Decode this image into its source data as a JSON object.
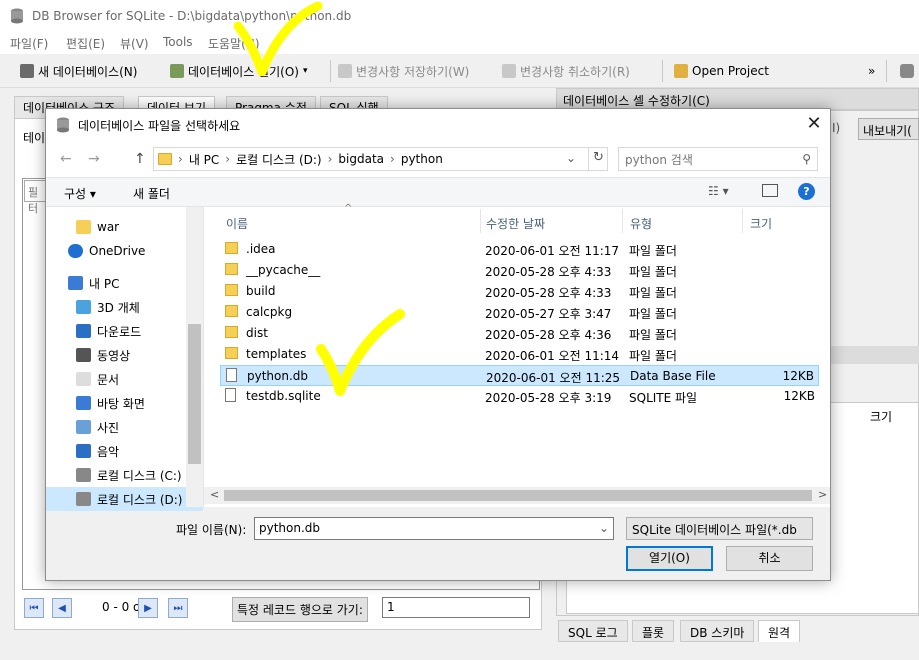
{
  "app": {
    "title": "DB Browser for SQLite - D:\\bigdata\\python\\python.db",
    "menu": [
      "파일(F)",
      "편집(E)",
      "뷰(V)",
      "Tools",
      "도움말(H)"
    ],
    "toolbar": {
      "new_db": "새 데이터베이스(N)",
      "open_db": "데이터베이스 열기(O)",
      "write_changes": "변경사항 저장하기(W)",
      "revert_changes": "변경사항 취소하기(R)",
      "open_project": "Open Project",
      "overflow": "»"
    },
    "left_tabs": [
      "데이터베이스 구조",
      "데이터 보기",
      "Pragma 수정",
      "SQL 실행"
    ],
    "table_label": "테이",
    "filter_text": "필터",
    "nav": {
      "first": "⏮",
      "prev": "◀",
      "records": "0 - 0 of 0",
      "next": "▶",
      "last": "⏭",
      "goto_label": "특정 레코드 행으로 가기:",
      "goto_value": "1"
    },
    "right_title": "데이터베이스 셀 수정하기(C)",
    "export_btn": "내보내기(",
    "i_btn": "I)",
    "size_header": "크기",
    "bottom_tabs": [
      "SQL 로그",
      "플롯",
      "DB 스키마",
      "원격"
    ]
  },
  "dialog": {
    "title": "데이터베이스 파일을 선택하세요",
    "close": "✕",
    "back": "←",
    "forward": "→",
    "up": "↑",
    "breadcrumb": [
      "내 PC",
      "로컬 디스크 (D:)",
      "bigdata",
      "python"
    ],
    "search_placeholder": "python 검색",
    "organize": "구성 ▾",
    "new_folder": "새 폴더",
    "view_icon": "☷ ▾",
    "help": "?",
    "nav_items": [
      {
        "label": "war",
        "icon": "folder-icon"
      },
      {
        "label": "OneDrive",
        "icon": "cloud-icon"
      },
      {
        "label": "내 PC",
        "icon": "pc-icon"
      },
      {
        "label": "3D 개체",
        "icon": "cube-icon"
      },
      {
        "label": "다운로드",
        "icon": "download-icon"
      },
      {
        "label": "동영상",
        "icon": "video-icon"
      },
      {
        "label": "문서",
        "icon": "document-icon"
      },
      {
        "label": "바탕 화면",
        "icon": "desktop-icon"
      },
      {
        "label": "사진",
        "icon": "pictures-icon"
      },
      {
        "label": "음악",
        "icon": "music-icon"
      },
      {
        "label": "로컬 디스크 (C:)",
        "icon": "drive-icon"
      },
      {
        "label": "로컬 디스크 (D:)",
        "icon": "drive-icon"
      }
    ],
    "columns": [
      "이름",
      "수정한 날짜",
      "유형",
      "크기"
    ],
    "files": [
      {
        "name": ".idea",
        "date": "2020-06-01 오전 11:17",
        "type": "파일 폴더",
        "size": "",
        "kind": "folder"
      },
      {
        "name": "__pycache__",
        "date": "2020-05-28 오후 4:33",
        "type": "파일 폴더",
        "size": "",
        "kind": "folder"
      },
      {
        "name": "build",
        "date": "2020-05-28 오후 4:33",
        "type": "파일 폴더",
        "size": "",
        "kind": "folder"
      },
      {
        "name": "calcpkg",
        "date": "2020-05-27 오후 3:47",
        "type": "파일 폴더",
        "size": "",
        "kind": "folder"
      },
      {
        "name": "dist",
        "date": "2020-05-28 오후 4:36",
        "type": "파일 폴더",
        "size": "",
        "kind": "folder"
      },
      {
        "name": "templates",
        "date": "2020-06-01 오전 11:14",
        "type": "파일 폴더",
        "size": "",
        "kind": "folder"
      },
      {
        "name": "python.db",
        "date": "2020-06-01 오전 11:25",
        "type": "Data Base File",
        "size": "12KB",
        "kind": "file"
      },
      {
        "name": "testdb.sqlite",
        "date": "2020-05-28 오후 3:19",
        "type": "SQLITE 파일",
        "size": "12KB",
        "kind": "file"
      }
    ],
    "filename_label": "파일 이름(N):",
    "filename_value": "python.db",
    "filetype": "SQLite 데이터베이스 파일(*.db",
    "open_btn": "열기(O)",
    "cancel_btn": "취소"
  },
  "colors": {
    "accent": "#0078d7",
    "selection": "#cce8ff",
    "annotation": "#ffff00"
  }
}
